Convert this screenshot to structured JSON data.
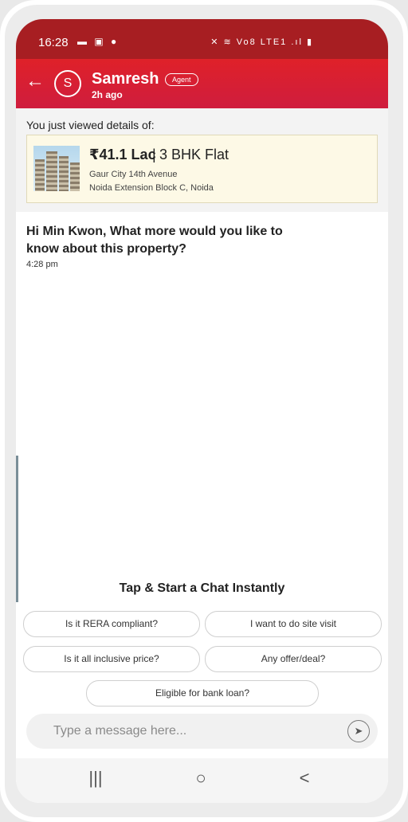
{
  "status": {
    "time": "16:28",
    "left_icons": "▬ ▣ ●",
    "right_icons": "✕ ≋ Vo8 LTE1 .ıl ▮"
  },
  "header": {
    "back_icon": "←",
    "avatar_initial": "S",
    "agent_name": "Samresh",
    "last_seen": "2h ago",
    "badge": "Agent"
  },
  "viewed": {
    "label": "You just viewed details of:",
    "price": "₹41.1 Lac",
    "separator": "|",
    "property_type": "3 BHK Flat",
    "address_line1": "Gaur City 14th Avenue",
    "address_line2": "Noida Extension Block C, Noida"
  },
  "message": {
    "text": "Hi Min Kwon, What more would you like to know about this property?",
    "time": "4:28 pm"
  },
  "quick_replies": {
    "title": "Tap & Start a Chat Instantly",
    "options": [
      "Is it RERA compliant?",
      "I want to do site visit",
      "Is it all inclusive price?",
      "Any offer/deal?",
      "Eligible for bank loan?"
    ]
  },
  "composer": {
    "placeholder": "Type a message here...",
    "send_icon": "➤"
  },
  "nav": {
    "recent": "|||",
    "home": "○",
    "back": "<"
  },
  "colors": {
    "header": "#df2129",
    "status_bar": "#a71e22",
    "card_bg": "#fdf9e6"
  }
}
